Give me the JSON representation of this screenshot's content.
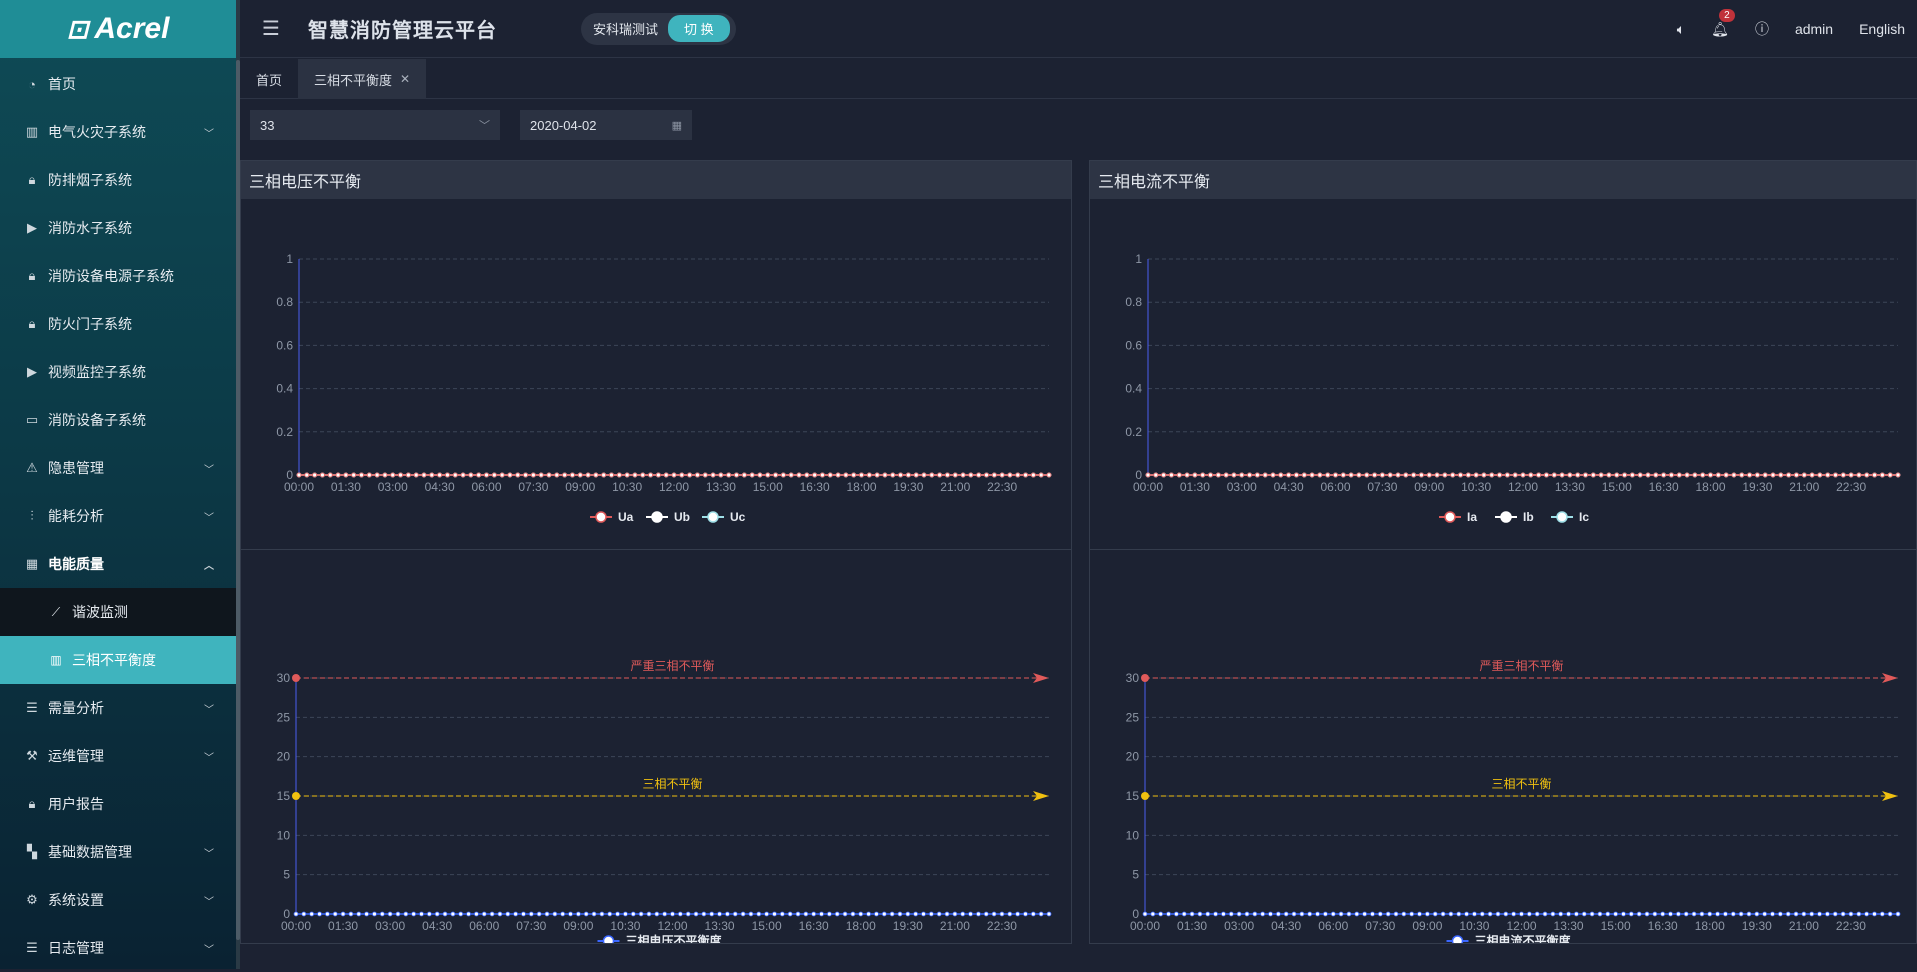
{
  "brand": {
    "logo_text": "Acrel"
  },
  "sidebar": {
    "items": [
      {
        "label": "首页",
        "icon": "dashboard-icon"
      },
      {
        "label": "电气火灾子系统",
        "icon": "chart-icon",
        "chevron": "down"
      },
      {
        "label": "防排烟子系统",
        "icon": "lock-icon"
      },
      {
        "label": "消防水子系统",
        "icon": "play-icon"
      },
      {
        "label": "消防设备电源子系统",
        "icon": "lock-icon"
      },
      {
        "label": "防火门子系统",
        "icon": "lock-icon"
      },
      {
        "label": "视频监控子系统",
        "icon": "play-icon"
      },
      {
        "label": "消防设备子系统",
        "icon": "camera-icon"
      },
      {
        "label": "隐患管理",
        "icon": "warning-icon",
        "chevron": "down"
      },
      {
        "label": "能耗分析",
        "icon": "sliders-icon",
        "chevron": "down"
      },
      {
        "label": "电能质量",
        "icon": "calendar-icon",
        "chevron": "up",
        "open": true
      },
      {
        "label": "需量分析",
        "icon": "list-icon",
        "chevron": "down"
      },
      {
        "label": "运维管理",
        "icon": "tool-icon",
        "chevron": "down"
      },
      {
        "label": "用户报告",
        "icon": "lock-icon"
      },
      {
        "label": "基础数据管理",
        "icon": "grid-icon",
        "chevron": "down"
      },
      {
        "label": "系统设置",
        "icon": "gear-icon",
        "chevron": "down"
      },
      {
        "label": "日志管理",
        "icon": "list-icon",
        "chevron": "down"
      }
    ],
    "subitems": [
      {
        "label": "谐波监测",
        "icon": "line-chart-icon"
      },
      {
        "label": "三相不平衡度",
        "icon": "bar-chart-icon",
        "active": true
      }
    ]
  },
  "header": {
    "title": "智慧消防管理云平台",
    "project_name": "安科瑞测试",
    "switch_label": "切 换",
    "notification_count": "2",
    "user": "admin",
    "language": "English"
  },
  "tabs": [
    {
      "label": "首页",
      "active": false
    },
    {
      "label": "三相不平衡度",
      "active": true,
      "closable": true
    }
  ],
  "filters": {
    "device_value": "33",
    "date_value": "2020-04-02"
  },
  "panels": {
    "voltage_title": "三相电压不平衡",
    "current_title": "三相电流不平衡"
  },
  "chart_data": [
    {
      "type": "line",
      "title": "",
      "x": [
        "00:00",
        "01:30",
        "03:00",
        "04:30",
        "06:00",
        "07:30",
        "09:00",
        "10:30",
        "12:00",
        "13:30",
        "15:00",
        "16:30",
        "18:00",
        "19:30",
        "21:00",
        "22:30"
      ],
      "ylim": [
        0,
        1
      ],
      "yticks": [
        "0",
        "0.2",
        "0.4",
        "0.6",
        "0.8",
        "1"
      ],
      "series": [
        {
          "name": "Ua",
          "values": "all 0",
          "color": "#e05a5a"
        },
        {
          "name": "Ub",
          "values": "all 0",
          "color": "#ffffff"
        },
        {
          "name": "Uc",
          "values": "all 0",
          "color": "#9fe0e8"
        }
      ],
      "legend": "bottom-center",
      "grid": true
    },
    {
      "type": "line",
      "title": "",
      "x": [
        "00:00",
        "01:30",
        "03:00",
        "04:30",
        "06:00",
        "07:30",
        "09:00",
        "10:30",
        "12:00",
        "13:30",
        "15:00",
        "16:30",
        "18:00",
        "19:30",
        "21:00",
        "22:30"
      ],
      "ylim": [
        0,
        1
      ],
      "yticks": [
        "0",
        "0.2",
        "0.4",
        "0.6",
        "0.8",
        "1"
      ],
      "series": [
        {
          "name": "Ia",
          "values": "all 0",
          "color": "#e05a5a"
        },
        {
          "name": "Ib",
          "values": "all 0",
          "color": "#ffffff"
        },
        {
          "name": "Ic",
          "values": "all 0",
          "color": "#9fe0e8"
        }
      ],
      "legend": "bottom-center",
      "grid": true
    },
    {
      "type": "line",
      "title": "",
      "x": [
        "00:00",
        "01:30",
        "03:00",
        "04:30",
        "06:00",
        "07:30",
        "09:00",
        "10:30",
        "12:00",
        "13:30",
        "15:00",
        "16:30",
        "18:00",
        "19:30",
        "21:00",
        "22:30"
      ],
      "ylim": [
        0,
        30
      ],
      "yticks": [
        "0",
        "5",
        "10",
        "15",
        "20",
        "25",
        "30"
      ],
      "series": [
        {
          "name": "三相电压不平衡度",
          "values": "all 0",
          "color": "#3a66ff"
        }
      ],
      "markLines": [
        {
          "label": "严重三相不平衡",
          "value": 30,
          "color": "#e05a5a"
        },
        {
          "label": "三相不平衡",
          "value": 15,
          "color": "#f0c010"
        }
      ],
      "legend": "bottom-center",
      "grid": true
    },
    {
      "type": "line",
      "title": "",
      "x": [
        "00:00",
        "01:30",
        "03:00",
        "04:30",
        "06:00",
        "07:30",
        "09:00",
        "10:30",
        "12:00",
        "13:30",
        "15:00",
        "16:30",
        "18:00",
        "19:30",
        "21:00",
        "22:30"
      ],
      "ylim": [
        0,
        30
      ],
      "yticks": [
        "0",
        "5",
        "10",
        "15",
        "20",
        "25",
        "30"
      ],
      "series": [
        {
          "name": "三相电流不平衡度",
          "values": "all 0",
          "color": "#3a66ff"
        }
      ],
      "markLines": [
        {
          "label": "严重三相不平衡",
          "value": 30,
          "color": "#e05a5a"
        },
        {
          "label": "三相不平衡",
          "value": 15,
          "color": "#f0c010"
        }
      ],
      "legend": "bottom-center",
      "grid": true
    }
  ]
}
